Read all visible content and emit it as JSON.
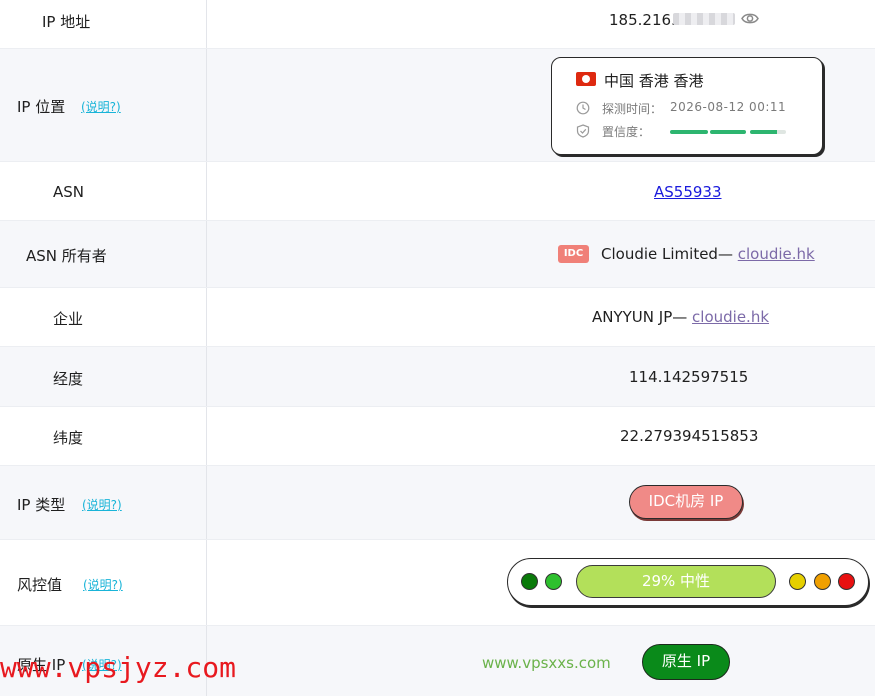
{
  "rows": {
    "ip": {
      "label": "IP 地址",
      "value_visible": "185.216."
    },
    "location": {
      "label": "IP 位置",
      "explain": "(说明?)",
      "city": "中国 香港 香港",
      "detect_label": "探测时间：",
      "detect_time": "2026-08-12 00:11",
      "confidence_label": "置信度：",
      "confidence_level": 0.85,
      "flag": "hk-flag-icon"
    },
    "asn": {
      "label": "ASN",
      "value": "AS55933"
    },
    "asn_owner": {
      "label": "ASN 所有者",
      "badge": "IDC",
      "name": "Cloudie Limited—",
      "link": "cloudie.hk"
    },
    "enterprise": {
      "label": "企业",
      "name": "ANYYUN JP—",
      "link": "cloudie.hk"
    },
    "longitude": {
      "label": "经度",
      "value": "114.142597515"
    },
    "latitude": {
      "label": "纬度",
      "value": "22.279394515853"
    },
    "ip_type": {
      "label": "IP 类型",
      "explain": "(说明?)",
      "value": "IDC机房 IP"
    },
    "risk": {
      "label": "风控值",
      "explain": "(说明?)",
      "value": "29%  中性",
      "percent": 29
    },
    "native": {
      "label": "原生 IP",
      "explain": "(说明?)",
      "value": "原生 IP"
    }
  },
  "watermarks": {
    "green": "www.vpsxxs.com",
    "red": "www.vpsjyz.com"
  },
  "colors": {
    "link_blue": "#1a1adc",
    "link_purple": "#7c6aa8",
    "explain_cyan": "#19b4d8",
    "idc_pill": "#f08a87",
    "risk_bar": "#b3e05a",
    "native_green": "#0a8a1a",
    "dots": [
      "#0a7a0a",
      "#2ec02e",
      "#e6d000",
      "#f0a000",
      "#e81010"
    ]
  }
}
